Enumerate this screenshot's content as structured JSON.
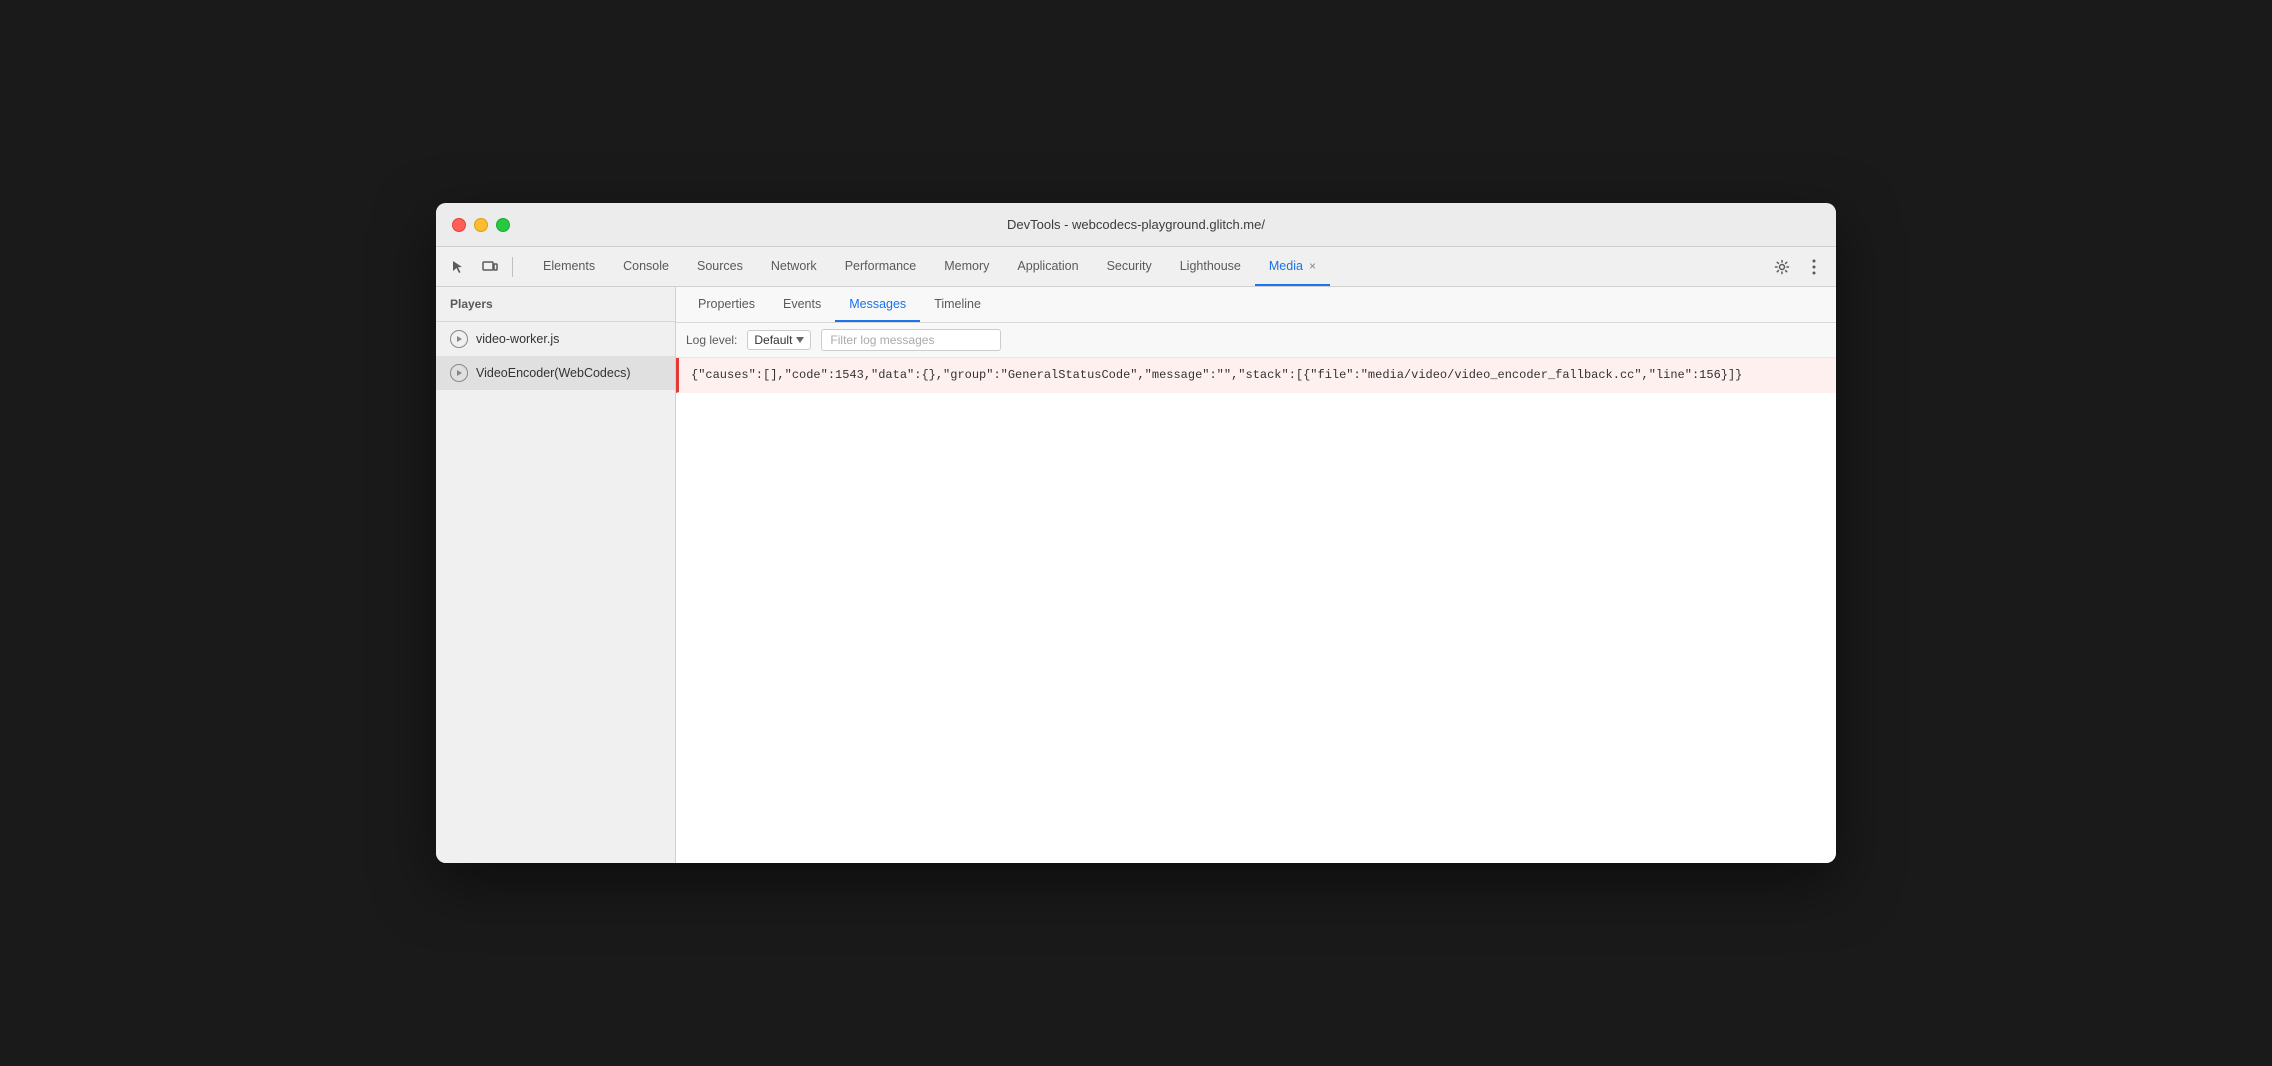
{
  "window": {
    "title": "DevTools - webcodecs-playground.glitch.me/"
  },
  "traffic_lights": {
    "close_label": "close",
    "minimize_label": "minimize",
    "maximize_label": "maximize"
  },
  "toolbar": {
    "cursor_icon": "⬚",
    "device_icon": "▭",
    "nav_tabs": [
      {
        "id": "elements",
        "label": "Elements",
        "active": false,
        "closable": false
      },
      {
        "id": "console",
        "label": "Console",
        "active": false,
        "closable": false
      },
      {
        "id": "sources",
        "label": "Sources",
        "active": false,
        "closable": false
      },
      {
        "id": "network",
        "label": "Network",
        "active": false,
        "closable": false
      },
      {
        "id": "performance",
        "label": "Performance",
        "active": false,
        "closable": false
      },
      {
        "id": "memory",
        "label": "Memory",
        "active": false,
        "closable": false
      },
      {
        "id": "application",
        "label": "Application",
        "active": false,
        "closable": false
      },
      {
        "id": "security",
        "label": "Security",
        "active": false,
        "closable": false
      },
      {
        "id": "lighthouse",
        "label": "Lighthouse",
        "active": false,
        "closable": false
      },
      {
        "id": "media",
        "label": "Media",
        "active": true,
        "closable": true
      }
    ],
    "settings_icon": "⚙",
    "more_icon": "⋮"
  },
  "sidebar": {
    "header": "Players",
    "items": [
      {
        "id": "video-worker",
        "label": "video-worker.js",
        "active": false
      },
      {
        "id": "video-encoder",
        "label": "VideoEncoder(WebCodecs)",
        "active": true
      }
    ]
  },
  "main": {
    "sub_tabs": [
      {
        "id": "properties",
        "label": "Properties",
        "active": false
      },
      {
        "id": "events",
        "label": "Events",
        "active": false
      },
      {
        "id": "messages",
        "label": "Messages",
        "active": true
      },
      {
        "id": "timeline",
        "label": "Timeline",
        "active": false
      }
    ],
    "log_controls": {
      "label": "Log level:",
      "select_value": "Default",
      "filter_placeholder": "Filter log messages"
    },
    "messages": [
      {
        "id": "msg-1",
        "type": "error",
        "text": "{\"causes\":[],\"code\":1543,\"data\":{},\"group\":\"GeneralStatusCode\",\"message\":\"\",\"stack\":[{\"file\":\"media/video/video_encoder_fallback.cc\",\"line\":156}]}"
      }
    ]
  }
}
